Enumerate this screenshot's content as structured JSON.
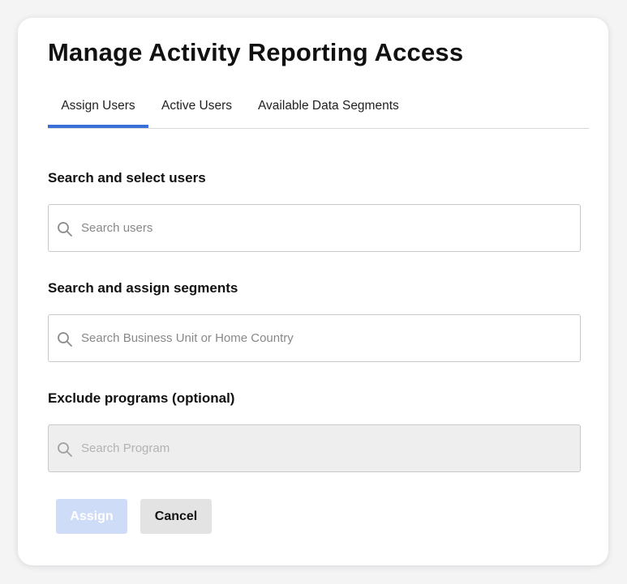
{
  "dialog": {
    "title": "Manage Activity Reporting Access"
  },
  "tabs": [
    {
      "label": "Assign Users",
      "active": true
    },
    {
      "label": "Active Users",
      "active": false
    },
    {
      "label": "Available Data Segments",
      "active": false
    }
  ],
  "users_section": {
    "label": "Search and select users",
    "placeholder": "Search users",
    "icon": "search-icon"
  },
  "segments_section": {
    "label": "Search and assign segments",
    "placeholder": "Search Business Unit or Home Country",
    "icon": "search-icon"
  },
  "programs_section": {
    "label": "Exclude programs (optional)",
    "placeholder": "Search Program",
    "icon": "search-icon",
    "disabled": true
  },
  "actions": {
    "assign_label": "Assign",
    "assign_disabled": true,
    "cancel_label": "Cancel"
  },
  "colors": {
    "accent": "#3b6fd8",
    "assign_disabled_bg": "#cfdcf7",
    "cancel_bg": "#e3e3e3",
    "disabled_field_bg": "#eeeeee"
  }
}
